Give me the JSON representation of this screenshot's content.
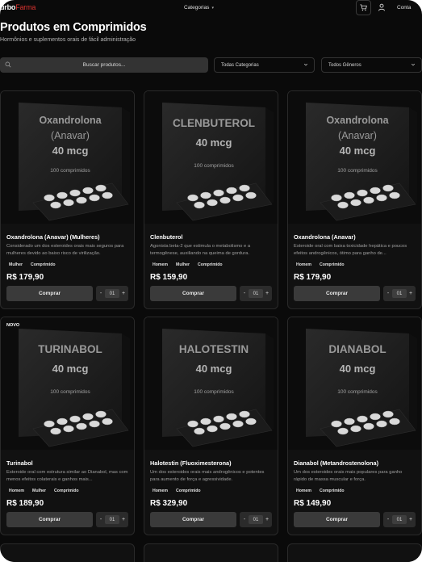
{
  "header": {
    "logo_main": "urbo",
    "logo_accent": "Farma",
    "nav_categories": "Categorias",
    "account": "Conta",
    "cart_icon": "cart-icon",
    "user_icon": "user-icon"
  },
  "page": {
    "title": "Produtos em Comprimidos",
    "subtitle": "Hormônios e suplementos orais de fácil administração"
  },
  "filters": {
    "search_placeholder": "Buscar produtos...",
    "search_icon": "search-icon",
    "category_value": "Todas Categorias",
    "gender_value": "Todos Gêneros"
  },
  "colors": {
    "background": "#0a0a0a",
    "card": "#111111",
    "accent": "#d8322f",
    "button": "#3a3a3a"
  },
  "products": [
    {
      "box_line1": "Oxandrolona",
      "box_line2": "(Anavar)",
      "box_dose": "40 mcg",
      "box_count": "100 comprimidos",
      "name": "Oxandrolona (Anavar) (Mulheres)",
      "description": "Considerado um dos esteroides orais mais seguros para mulheres devido ao baixo risco de virilização.",
      "tags": [
        "Mulher",
        "Comprimido"
      ],
      "price": "R$ 179,90",
      "buy_label": "Comprar",
      "qty": "01",
      "badge": ""
    },
    {
      "box_line1": "CLENBUTEROL",
      "box_line2": "",
      "box_dose": "40 mcg",
      "box_count": "100 comprimidos",
      "name": "Clenbuterol",
      "description": "Agonista beta-2 que estimula o metabolismo e a termogênese, auxiliando na queima de gordura.",
      "tags": [
        "Homem",
        "Mulher",
        "Comprimido"
      ],
      "price": "R$ 159,90",
      "buy_label": "Comprar",
      "qty": "01",
      "badge": ""
    },
    {
      "box_line1": "Oxandrolona",
      "box_line2": "(Anavar)",
      "box_dose": "40 mcg",
      "box_count": "100 comprimidos",
      "name": "Oxandrolona (Anavar)",
      "description": "Esteroide oral com baixa toxicidade hepática e poucos efeitos androgênicos, ótimo para ganho de...",
      "tags": [
        "Homem",
        "Comprimido"
      ],
      "price": "R$ 179,90",
      "buy_label": "Comprar",
      "qty": "01",
      "badge": ""
    },
    {
      "box_line1": "TURINABOL",
      "box_line2": "",
      "box_dose": "40 mcg",
      "box_count": "100 comprimidos",
      "name": "Turinabol",
      "description": "Esteroide oral com estrutura similar ao Dianabol, mas com menos efeitos colaterais e ganhos mais...",
      "tags": [
        "Homem",
        "Mulher",
        "Comprimido"
      ],
      "price": "R$ 189,90",
      "buy_label": "Comprar",
      "qty": "01",
      "badge": "NOVO"
    },
    {
      "box_line1": "HALOTESTIN",
      "box_line2": "",
      "box_dose": "40 mcg",
      "box_count": "100 comprimidos",
      "name": "Halotestin (Fluoximesterona)",
      "description": "Um dos esteroides orais mais androgênicos e potentes para aumento de força e agressividade.",
      "tags": [
        "Homem",
        "Comprimido"
      ],
      "price": "R$ 329,90",
      "buy_label": "Comprar",
      "qty": "01",
      "badge": ""
    },
    {
      "box_line1": "DIANABOL",
      "box_line2": "",
      "box_dose": "40 mcg",
      "box_count": "100 comprimidos",
      "name": "Dianabol (Metandrostenolona)",
      "description": "Um dos esteroides orais mais populares para ganho rápido de massa muscular e força.",
      "tags": [
        "Homem",
        "Comprimido"
      ],
      "price": "R$ 149,90",
      "buy_label": "Comprar",
      "qty": "01",
      "badge": ""
    }
  ]
}
